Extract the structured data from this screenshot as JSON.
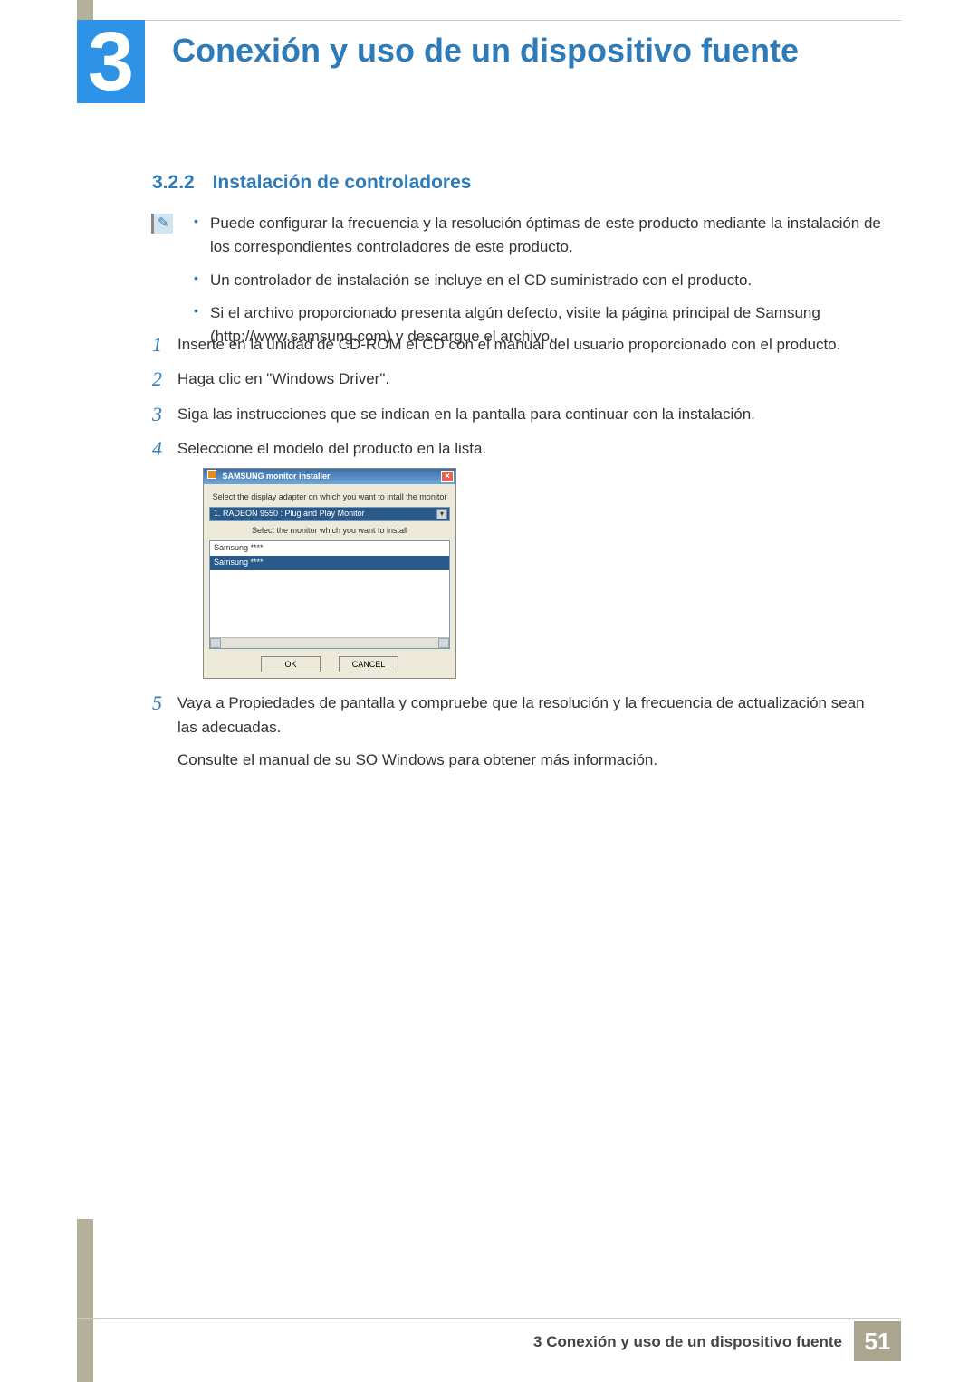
{
  "chapter": {
    "number": "3",
    "title": "Conexión y uso de un dispositivo fuente"
  },
  "section": {
    "number": "3.2.2",
    "title": "Instalación de controladores"
  },
  "notes": [
    "Puede configurar la frecuencia y la resolución óptimas de este producto mediante la instalación de los correspondientes controladores de este producto.",
    "Un controlador de instalación se incluye en el CD suministrado con el producto.",
    "Si el archivo proporcionado presenta algún defecto, visite la página principal de Samsung (http://www.samsung.com) y descargue el archivo."
  ],
  "steps": {
    "s1": {
      "num": "1",
      "text": "Inserte en la unidad de CD-ROM el CD con el manual del usuario proporcionado con el producto."
    },
    "s2": {
      "num": "2",
      "text": "Haga clic en \"Windows Driver\"."
    },
    "s3": {
      "num": "3",
      "text": "Siga las instrucciones que se indican en la pantalla para continuar con la instalación."
    },
    "s4": {
      "num": "4",
      "text": "Seleccione el modelo del producto en la lista."
    },
    "s5": {
      "num": "5",
      "text": "Vaya a Propiedades de pantalla y compruebe que la resolución y la frecuencia de actualización sean las adecuadas."
    },
    "s5b": "Consulte el manual de su SO Windows para obtener más información."
  },
  "dialog": {
    "title": "SAMSUNG monitor installer",
    "label1": "Select the display adapter on which you want to intall the monitor",
    "adapter": "1. RADEON 9550 : Plug and Play Monitor",
    "label2": "Select the monitor which you want to install",
    "list_item1": "Samsung ****",
    "list_item2": "Samsung ****",
    "ok": "OK",
    "cancel": "CANCEL"
  },
  "footer": {
    "text": "3 Conexión y uso de un dispositivo fuente",
    "page": "51"
  }
}
